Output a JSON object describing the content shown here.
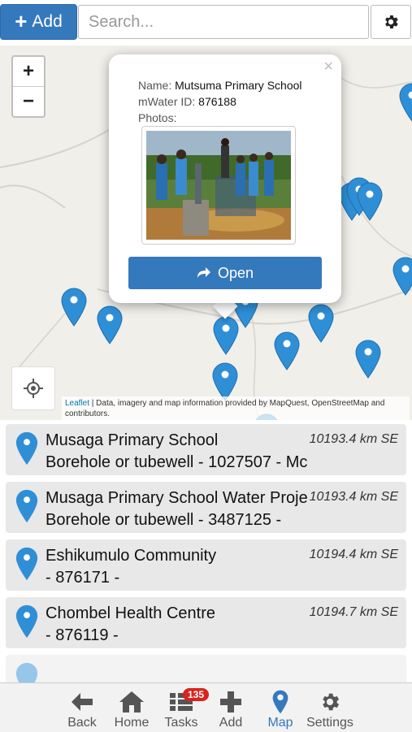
{
  "toolbar": {
    "add_label": "Add",
    "search_placeholder": "Search..."
  },
  "map": {
    "zoom_in": "+",
    "zoom_out": "−",
    "attribution_link": "Leaflet",
    "attribution_text": " | Data, imagery and map information provided by MapQuest, OpenStreetMap and contributors."
  },
  "popup": {
    "close": "×",
    "name_label": "Name:",
    "name_value": "Mutsuma Primary School",
    "id_label": "mWater ID:",
    "id_value": "876188",
    "photos_label": "Photos:",
    "open_label": "Open"
  },
  "list": [
    {
      "name": "Musaga Primary School",
      "sub": "Borehole or tubewell - 1027507 - Mc",
      "dist": "10193.4 km SE"
    },
    {
      "name": "Musaga Primary School Water Projec",
      "sub": "Borehole or tubewell - 3487125 -",
      "dist": "10193.4 km SE"
    },
    {
      "name": "Eshikumulo Community",
      "sub": "- 876171 -",
      "dist": "10194.4 km SE"
    },
    {
      "name": "Chombel Health Centre",
      "sub": "- 876119 -",
      "dist": "10194.7 km SE"
    }
  ],
  "nav": {
    "back": "Back",
    "home": "Home",
    "tasks": "Tasks",
    "tasks_badge": "135",
    "add": "Add",
    "map": "Map",
    "settings": "Settings"
  },
  "colors": {
    "accent": "#3579bd",
    "marker": "#2f8fd6",
    "badge": "#d9231d"
  }
}
